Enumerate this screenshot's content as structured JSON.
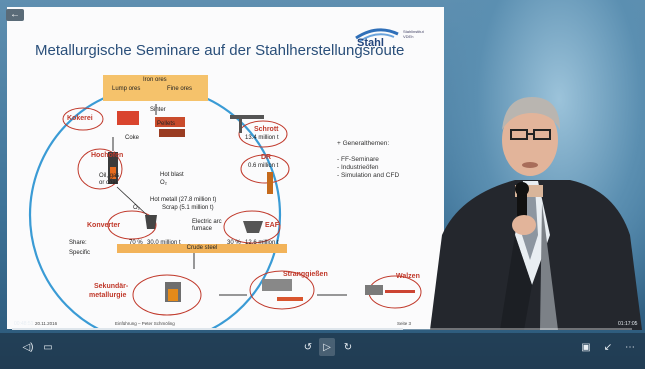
{
  "slide": {
    "title": "Metallurgische Seminare auf der Stahlherstellungsroute",
    "logo_word": "Stahl",
    "logo_sub": "Stahlinstitut VDEh",
    "diagram": {
      "ore_header": "Iron ores",
      "lump": "Lump ores",
      "fine": "Fine ores",
      "kokerei": "Kokerei",
      "sinter": "Sinter",
      "pellets": "Pellets",
      "coke": "Coke",
      "hochofen": "Hochofen",
      "oil_gas": "Oil, gas or coal",
      "hot_blast": "Hot blast",
      "o2_a": "O₂",
      "hot_metal": "Hot metall (27.8 million t)",
      "scrap": "Scrap (5.1 million t)",
      "o2_b": "O₂",
      "schrott": "Schrott",
      "schrott_val": "13.4 million t",
      "dr": "DR",
      "dr_val": "0.6 million t",
      "eaf_text": "Electric arc furnace",
      "eaf": "EAF",
      "konverter": "Konverter",
      "share": "Share:",
      "specific": "Specific",
      "share_conv": "70 %",
      "conv_val": "30.0 million t",
      "share_eaf": "30 %",
      "eaf_val": "12.6 million t",
      "crude": "Crude steel",
      "sekundar": "Sekundär-",
      "metallurgie": "metallurgie",
      "strang": "Stranggießen",
      "walzen": "Walzen"
    },
    "general": {
      "head": "+ Generalthemen:",
      "items": [
        "- FF-Seminare",
        "- Industrieöfen",
        "- Simulation and CFD"
      ]
    },
    "footer": {
      "date": "20.11.2016",
      "center": "Einführung – Peter Schmöling",
      "page": "Seite 3"
    }
  },
  "player": {
    "time_current": "00:48:51",
    "time_total": "01:17:05",
    "progress": 0.63,
    "back_icon": "back-arrow-icon"
  }
}
